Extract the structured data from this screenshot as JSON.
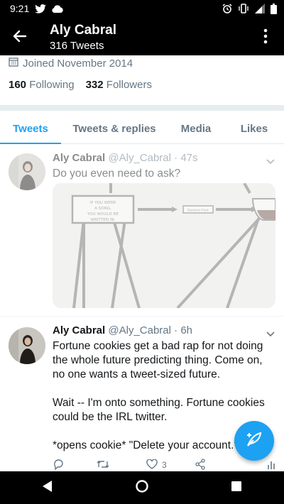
{
  "status_bar": {
    "time": "9:21"
  },
  "header": {
    "name": "Aly Cabral",
    "tweet_count": "316 Tweets"
  },
  "profile": {
    "joined": "Joined November 2014",
    "following_count": "160",
    "following_label": "Following",
    "followers_count": "332",
    "followers_label": "Followers"
  },
  "tabs": [
    {
      "label": "Tweets",
      "active": true
    },
    {
      "label": "Tweets & replies",
      "active": false
    },
    {
      "label": "Media",
      "active": false
    },
    {
      "label": "Likes",
      "active": false
    }
  ],
  "tweets": [
    {
      "name": "Aly Cabral",
      "handle": "@Aly_Cabral",
      "time": "47s",
      "text": "Do you even need to ask?",
      "media": {
        "box1": "IF YOU WERE A SONG, YOU WOULD BE WRITTEN IN:",
        "box2": "Ramone Font"
      }
    },
    {
      "name": "Aly Cabral",
      "handle": "@Aly_Cabral",
      "time": "6h",
      "paragraphs": [
        "Fortune cookies get a bad rap for not doing the whole future predicting thing. Come on, no one wants a tweet-sized future.",
        "Wait -- I'm onto something. Fortune cookies could be the IRL twitter.",
        "*opens cookie* \"Delete your account.\""
      ],
      "like_count": "3"
    }
  ],
  "colors": {
    "accent": "#1da1f2",
    "secondary_text": "#657786"
  }
}
